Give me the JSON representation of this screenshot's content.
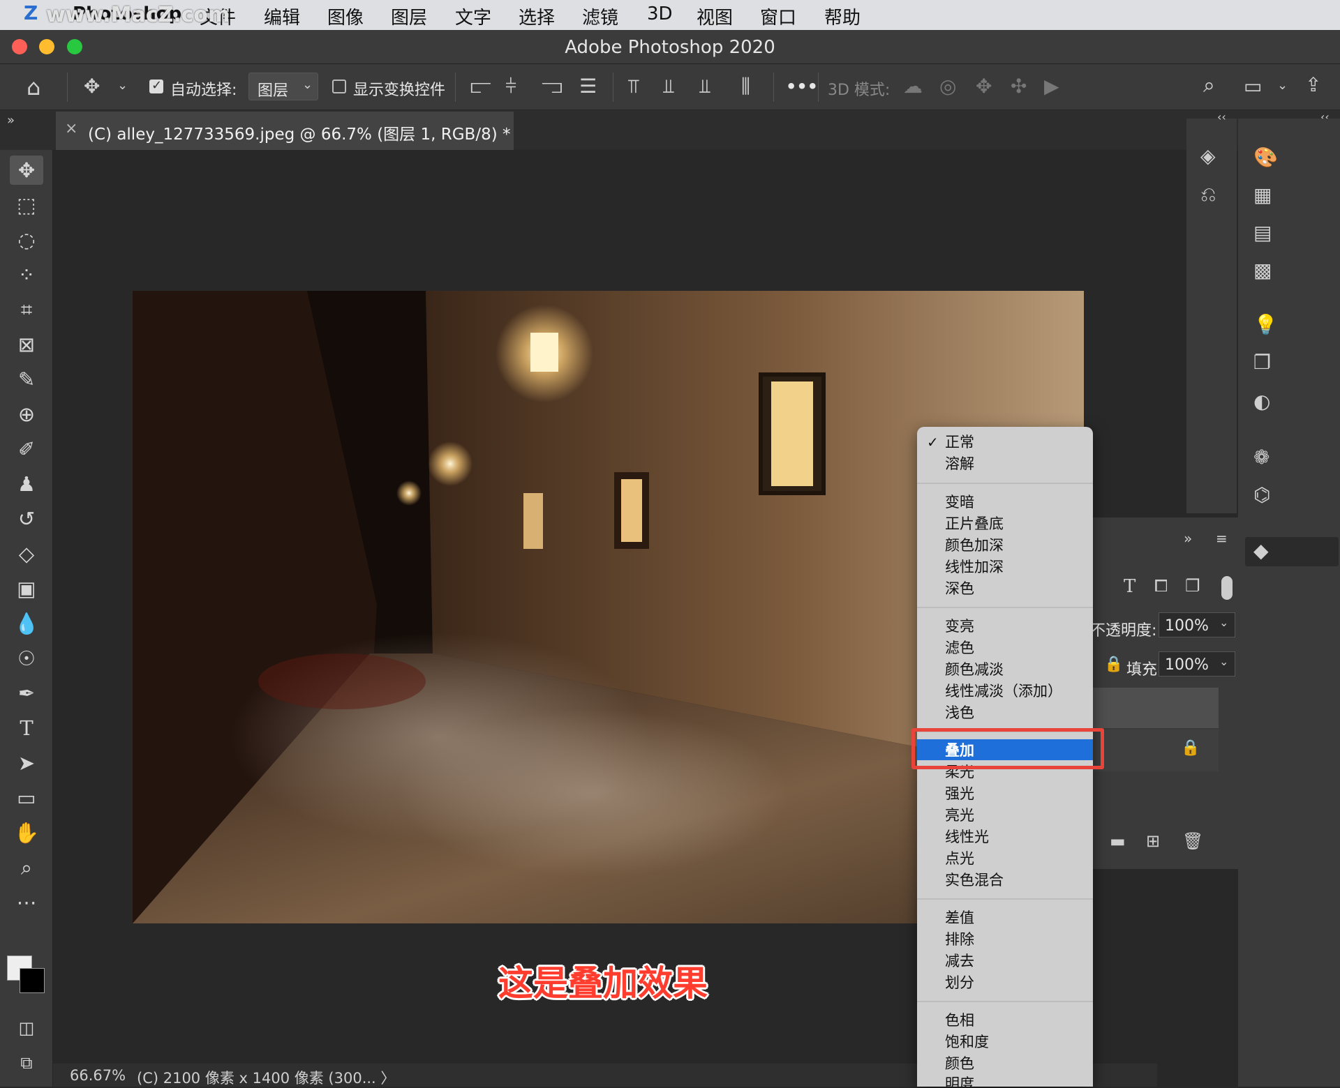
{
  "menubar": {
    "watermark": "www.MacZ.com",
    "app": "Photoshop",
    "items": [
      "文件",
      "编辑",
      "图像",
      "图层",
      "文字",
      "选择",
      "滤镜",
      "3D",
      "视图",
      "窗口",
      "帮助"
    ]
  },
  "window": {
    "title": "Adobe Photoshop 2020"
  },
  "options_bar": {
    "auto_select_label": "自动选择:",
    "auto_select_checked": true,
    "auto_select_target": "图层",
    "show_transform_label": "显示变换控件",
    "show_transform_checked": false,
    "more_label": "•••",
    "mode_3d_label": "3D 模式:"
  },
  "document_tab": {
    "close": "×",
    "title": "(C) alley_127733569.jpeg @ 66.7% (图层 1, RGB/8) *"
  },
  "layers_panel": {
    "opacity_label": "不透明度:",
    "opacity_value": "100%",
    "fill_label": "填充:",
    "fill_value": "100%"
  },
  "blend_menu": {
    "groups": [
      [
        "正常",
        "溶解"
      ],
      [
        "变暗",
        "正片叠底",
        "颜色加深",
        "线性加深",
        "深色"
      ],
      [
        "变亮",
        "滤色",
        "颜色减淡",
        "线性减淡（添加）",
        "浅色"
      ],
      [
        "叠加",
        "柔光",
        "强光",
        "亮光",
        "线性光",
        "点光",
        "实色混合"
      ],
      [
        "差值",
        "排除",
        "减去",
        "划分"
      ],
      [
        "色相",
        "饱和度",
        "颜色",
        "明度"
      ]
    ],
    "checked": "正常",
    "selected": "叠加",
    "checkmark": "✓"
  },
  "caption": "这是叠加效果",
  "status_bar": {
    "zoom": "66.67%",
    "info": "(C) 2100 像素 x 1400 像素 (300... 〉"
  },
  "colors": {
    "highlight": "#1e6fd9",
    "annotation_red": "#e8443a",
    "caption_red": "#ff3d2e"
  },
  "toolbar_icons": [
    "move-icon",
    "marquee-icon",
    "lasso-icon",
    "quick-select-icon",
    "crop-icon",
    "frame-icon",
    "eyedropper-icon",
    "healing-icon",
    "brush-icon",
    "stamp-icon",
    "history-brush-icon",
    "eraser-icon",
    "gradient-icon",
    "blur-icon",
    "dodge-icon",
    "pen-icon",
    "type-icon",
    "path-select-icon",
    "rectangle-icon",
    "hand-icon",
    "zoom-icon",
    "more-tools-icon"
  ]
}
